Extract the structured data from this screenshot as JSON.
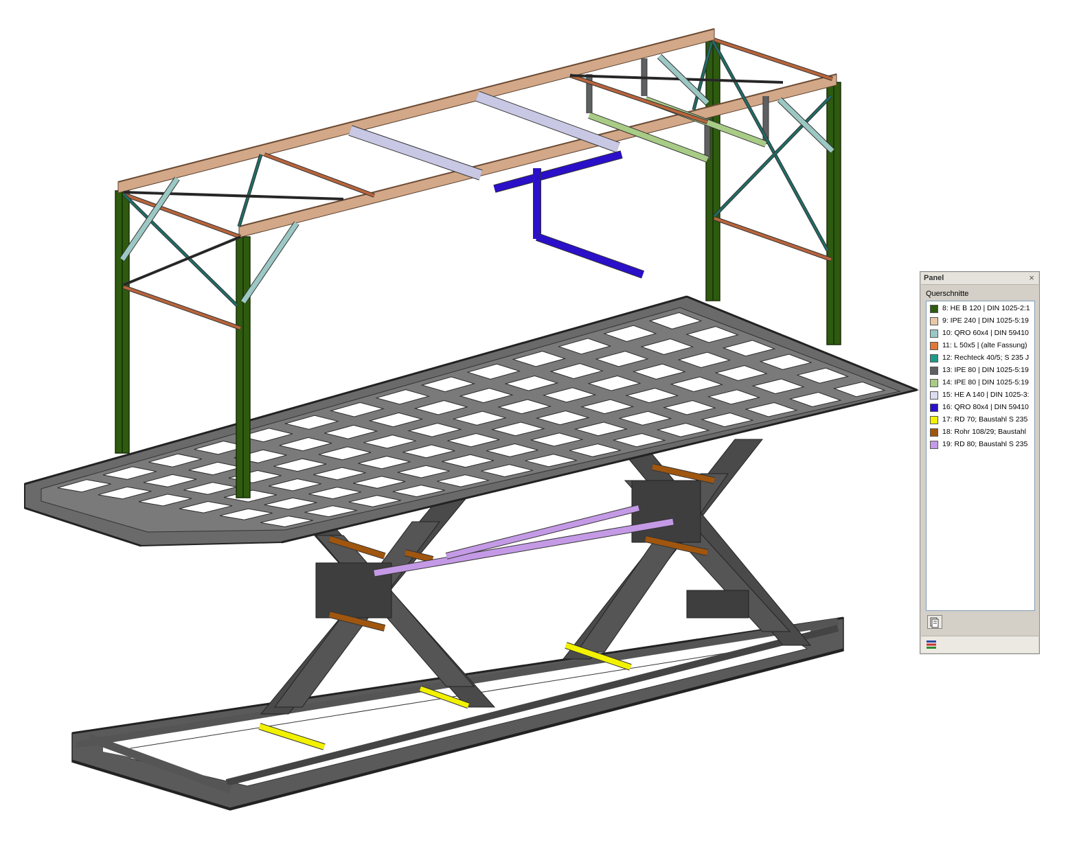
{
  "panel": {
    "title": "Panel",
    "close_glyph": "×",
    "section_label": "Querschnitte",
    "items": [
      {
        "label": "8: HE B 120 | DIN 1025-2:1",
        "color": "#2e5b0f"
      },
      {
        "label": "9: IPE 240 | DIN 1025-5:19",
        "color": "#e8c8a6"
      },
      {
        "label": "10: QRO 60x4 | DIN 59410",
        "color": "#9cc8c4"
      },
      {
        "label": "11: L 50x5 | (alte Fassung)",
        "color": "#e07838"
      },
      {
        "label": "12: Rechteck 40/5; S 235 J",
        "color": "#1e9a88"
      },
      {
        "label": "13: IPE 80 | DIN 1025-5:19",
        "color": "#5e6062"
      },
      {
        "label": "14: IPE 80 | DIN 1025-5:19",
        "color": "#a8cc86"
      },
      {
        "label": "15: HE A 140 | DIN 1025-3:",
        "color": "#dcdcf2"
      },
      {
        "label": "16: QRO 80x4 | DIN 59410",
        "color": "#2a10c8"
      },
      {
        "label": "17: RD 70; Baustahl S 235",
        "color": "#f2f200"
      },
      {
        "label": "18: Rohr 108/29; Baustahl",
        "color": "#a0560e"
      },
      {
        "label": "19: RD 80; Baustahl S 235",
        "color": "#c49ae6"
      }
    ],
    "tool_button_icon": "panel-options-icon",
    "footer_icon": "cross-section-colors-icon"
  },
  "model": {
    "column_color": "#2e5b0f",
    "beam_color": "#d2a888",
    "brace_color": "#9cc8c4",
    "angle_color": "#b8643c",
    "rect_color": "#1e6e66",
    "platform_color": "#4a4a4a",
    "blue_member_color": "#2a10c8",
    "yellow_rod_color": "#f2f200",
    "purple_rod_color": "#c49ae6",
    "rohr_color": "#a0560e",
    "hea_color": "#c8c8e4",
    "ipe80_gray_color": "#5e6062",
    "ipe80_green_color": "#a8cc86"
  }
}
